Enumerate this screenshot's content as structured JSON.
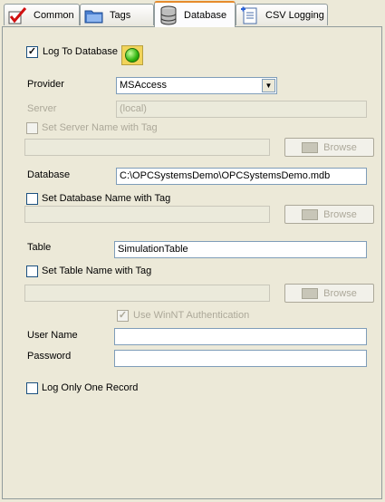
{
  "tabs": [
    {
      "label": "Common",
      "icon": "checkmark-icon"
    },
    {
      "label": "Tags",
      "icon": "folder-icon"
    },
    {
      "label": "Database",
      "icon": "database-icon"
    },
    {
      "label": "CSV Logging",
      "icon": "csv-document-icon"
    }
  ],
  "active_tab": "Database",
  "colors": {
    "led_status": "#2fb40f",
    "active_tab_accent": "#e68b2c"
  },
  "form": {
    "log_to_database": {
      "label": "Log To Database",
      "checked": true,
      "check_mark": "✓"
    },
    "provider": {
      "label": "Provider",
      "value": "MSAccess",
      "arrow": "▼"
    },
    "server": {
      "label": "Server",
      "placeholder": "(local)"
    },
    "set_server_name_with_tag": {
      "label": "Set Server Name with Tag",
      "checked": false
    },
    "server_browse": {
      "label": "Browse"
    },
    "database": {
      "label": "Database",
      "value": "C:\\OPCSystemsDemo\\OPCSystemsDemo.mdb"
    },
    "set_database_name_with_tag": {
      "label": "Set Database Name with Tag",
      "checked": false
    },
    "database_browse": {
      "label": "Browse"
    },
    "table": {
      "label": "Table",
      "value": "SimulationTable"
    },
    "set_table_name_with_tag": {
      "label": "Set Table Name with Tag",
      "checked": false
    },
    "table_browse": {
      "label": "Browse"
    },
    "use_winnt_auth": {
      "label": "Use WinNT Authentication",
      "checked": true,
      "check_mark": "✓"
    },
    "user_name": {
      "label": "User Name",
      "value": ""
    },
    "password": {
      "label": "Password",
      "value": ""
    },
    "log_only_one_record": {
      "label": "Log Only One Record",
      "checked": false
    }
  }
}
